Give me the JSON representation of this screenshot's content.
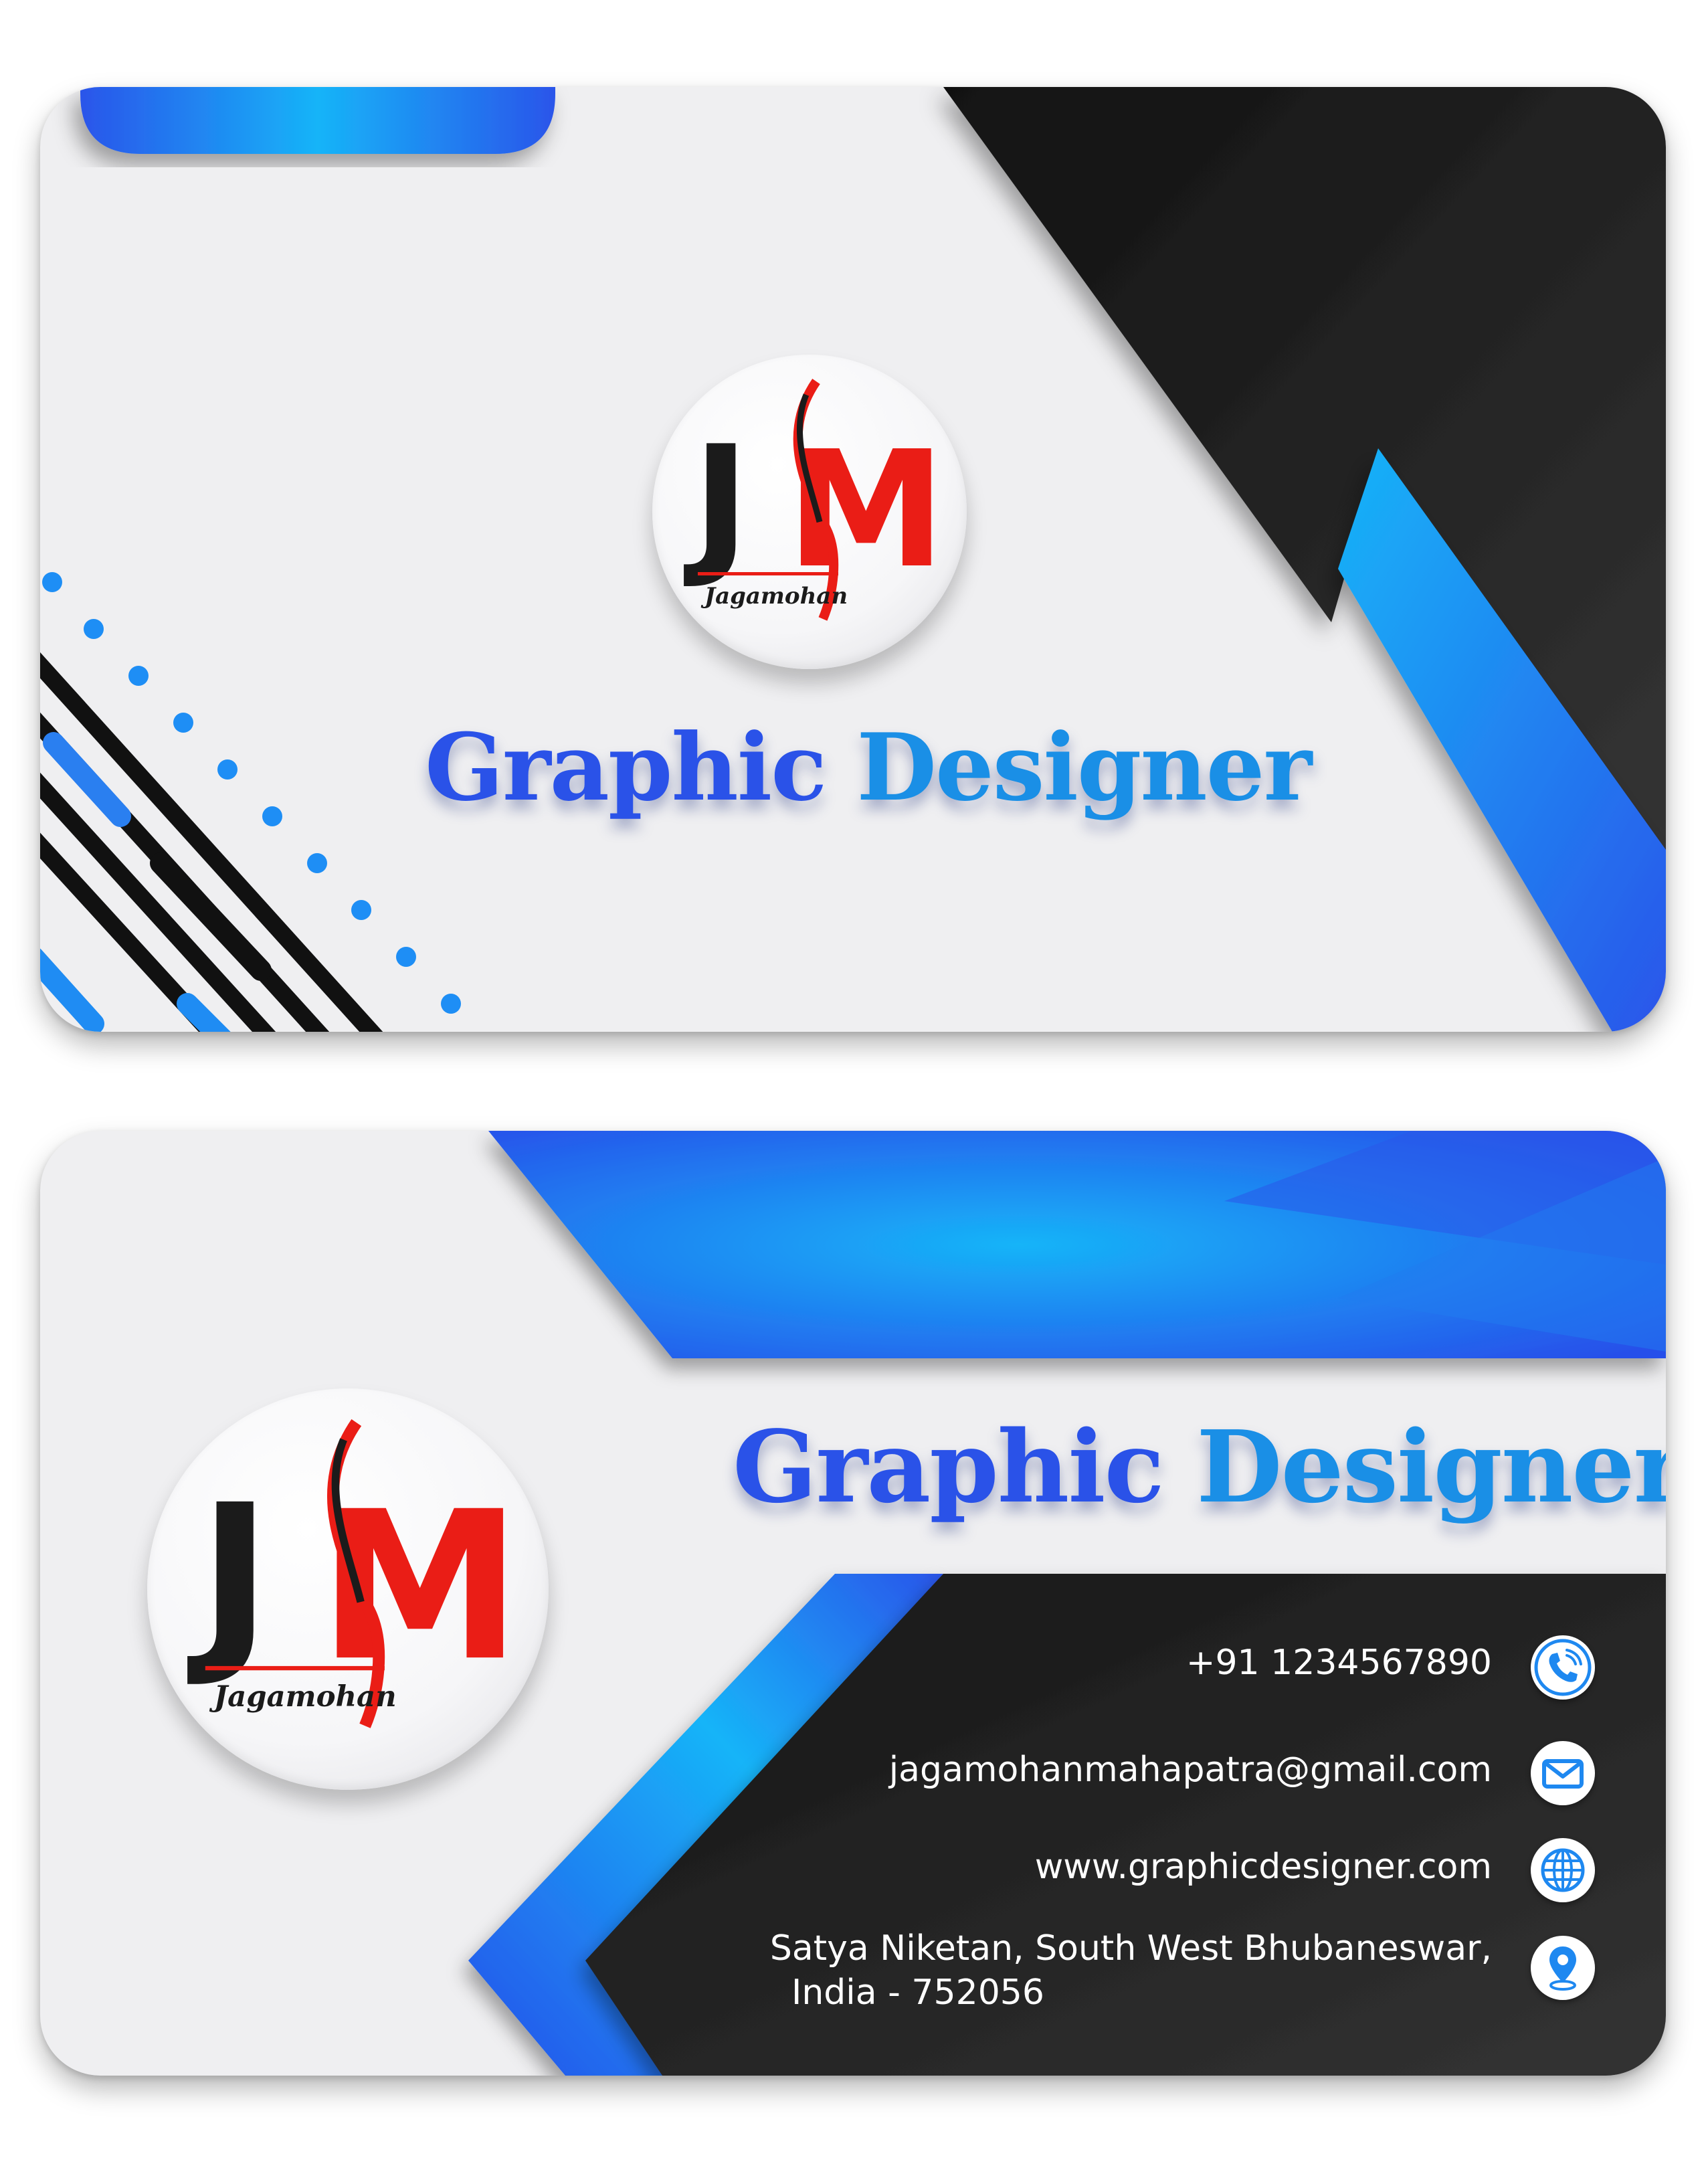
{
  "logo": {
    "monogram_left": "J",
    "monogram_right": "M",
    "name": "Jagamohan"
  },
  "front": {
    "title_word1": "Graphic",
    "title_word2": "Designer"
  },
  "back": {
    "title_word1": "Graphic",
    "title_word2": "Designer",
    "contacts": {
      "phone": "+91 1234567890",
      "email": "jagamohanmahapatra@gmail.com",
      "website": "www.graphicdesigner.com",
      "address_line1": "Satya Niketan, South West Bhubaneswar,",
      "address_line2": "India - 752056"
    }
  },
  "icons": {
    "phone": "phone-icon",
    "email": "email-icon",
    "website": "globe-icon",
    "address": "location-pin-icon"
  },
  "colors": {
    "blue_dark": "#2a52e8",
    "blue_light": "#15aef7",
    "black": "#1b1b1b",
    "red": "#ea1d16",
    "card_bg": "#efeff1"
  }
}
